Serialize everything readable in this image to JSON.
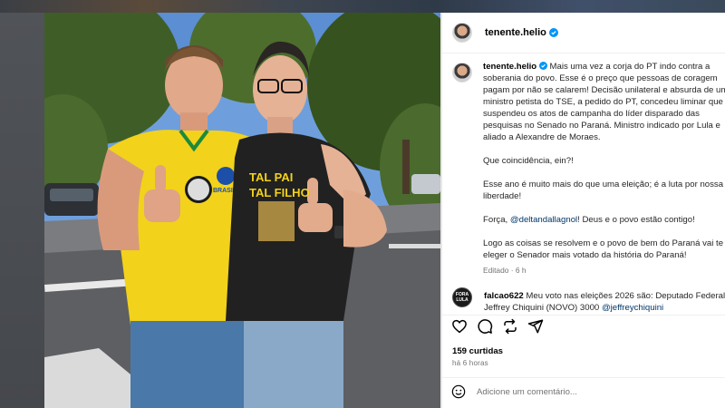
{
  "post": {
    "username": "tenente.helio",
    "caption_lines": [
      "Mais uma vez a corja do PT indo contra a soberania do povo. Esse é o preço que pessoas de coragem pagam por não se calarem! Decisão unilateral e absurda de um ministro petista do TSE, a pedido do PT, concedeu liminar que suspendeu os atos de campanha do líder disparado das pesquisas no Senado no Paraná. Ministro indicado por Lula e aliado a Alexandre de Moraes.",
      "Que coincidência, ein?!",
      "Esse ano é muito mais do que uma eleição; é a luta por nossa liberdade!"
    ],
    "force_prefix": "Força,",
    "force_mention": "@deltandallagnol",
    "force_suffix": "! Deus e o povo estão contigo!",
    "final_line": "Logo as coisas se resolvem e o povo de bem do Paraná vai te eleger o Senador mais votado da história do Paraná!",
    "edited": "Editado · 6 h"
  },
  "comment": {
    "avatar_text": "FORA LULA",
    "username": "falcao622",
    "text": "Meu voto nas eleições 2026 são: Deputado Federal Jeffrey Chiquini (NOVO) 3000",
    "mention": "@jeffreychiquini"
  },
  "stats": {
    "likes": "159 curtidas",
    "time": "há 6 horas"
  },
  "add_comment": {
    "placeholder": "Adicione um comentário..."
  },
  "photo_shirt_text": {
    "line1": "TAL PAI",
    "line2": "TAL FILHO",
    "brasil": "BRASIL"
  },
  "colors": {
    "verified_blue": "#0095f6",
    "mention_blue": "#00376b",
    "jersey_yellow": "#f2d21b"
  }
}
